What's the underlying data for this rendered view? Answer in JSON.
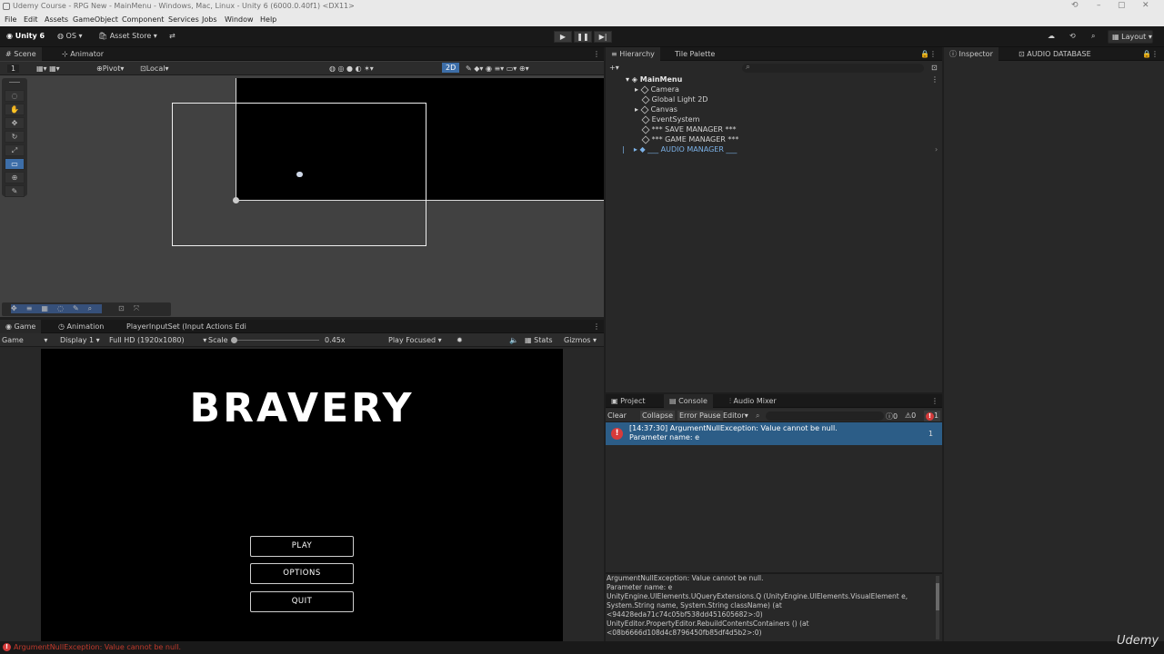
{
  "window": {
    "title": "Udemy Course - RPG New - MainMenu - Windows, Mac, Linux - Unity 6 (6000.0.40f1) <DX11>",
    "controls": [
      "–",
      "▢",
      "✕"
    ]
  },
  "menu": [
    "File",
    "Edit",
    "Assets",
    "GameObject",
    "Component",
    "Services",
    "Jobs",
    "Window",
    "Help"
  ],
  "toolbar": {
    "unity": "Unity 6",
    "os": "OS",
    "asset_store": "Asset Store",
    "layout": "Layout"
  },
  "scene": {
    "tabs": [
      "Scene",
      "Animator"
    ],
    "pivot": "Pivot",
    "local": "Local",
    "view_2d": "2D",
    "grid_value": "1"
  },
  "game": {
    "tabs": [
      "Game",
      "Animation",
      "PlayerInputSet (Input Actions Edi"
    ],
    "mode": "Game",
    "display": "Display 1",
    "resolution": "Full HD (1920x1080)",
    "scale_label": "Scale",
    "scale_value": "0.45x",
    "play_focused": "Play Focused",
    "stats": "Stats",
    "gizmos": "Gizmos",
    "title": "BRAVERY",
    "buttons": [
      "PLAY",
      "OPTIONS",
      "QUIT"
    ]
  },
  "hierarchy": {
    "tabs": [
      "Hierarchy",
      "Tile Palette"
    ],
    "root": "MainMenu",
    "items": [
      "Camera",
      "Global Light 2D",
      "Canvas",
      "EventSystem",
      "*** SAVE MANAGER ***",
      "*** GAME MANAGER ***",
      "___ AUDIO MANAGER ___"
    ]
  },
  "inspector": {
    "tabs": [
      "Inspector",
      "AUDIO DATABASE"
    ]
  },
  "console": {
    "tabs": [
      "Project",
      "Console",
      "Audio Mixer"
    ],
    "toolbar": [
      "Clear",
      "Collapse",
      "Error Pause",
      "Editor"
    ],
    "counts": {
      "logs": "0",
      "warnings": "0",
      "errors": "1"
    },
    "entry_line1": "[14:37:30] ArgumentNullException: Value cannot be null.",
    "entry_line2": "Parameter name: e",
    "entry_count": "1",
    "details": [
      "ArgumentNullException: Value cannot be null.",
      "Parameter name: e",
      "UnityEngine.UIElements.UQueryExtensions.Q (UnityEngine.UIElements.VisualElement e,",
      "System.String name, System.String className) (at",
      "<94428eda71c74c05bf538dd451605682>:0)",
      "UnityEditor.PropertyEditor.RebuildContentsContainers () (at",
      "<08b6666d108d4c8796450fb85df4d5b2>:0)"
    ]
  },
  "status": {
    "message": "ArgumentNullException: Value cannot be null."
  },
  "watermark": "Udemy",
  "colors": {
    "accent": "#3d6ea8",
    "selection": "#2c5d87",
    "error": "#d63b3b"
  }
}
